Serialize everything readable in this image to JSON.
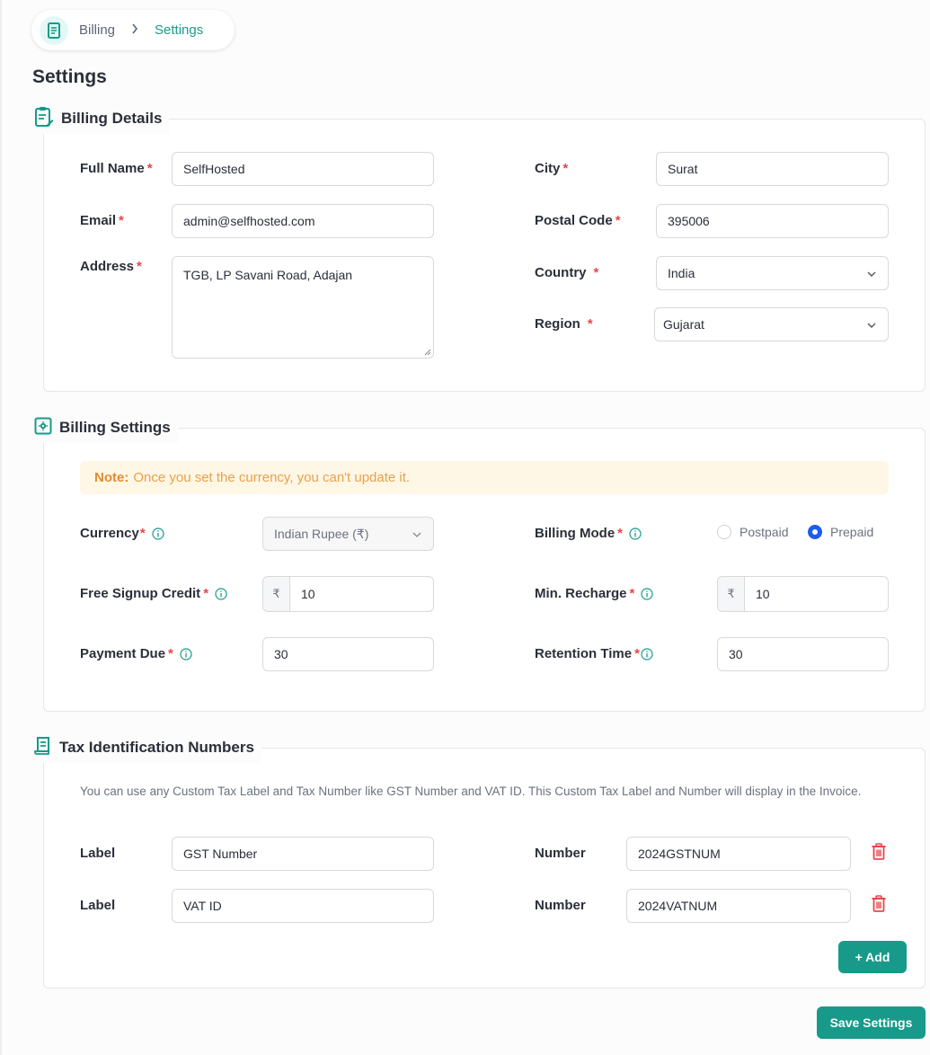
{
  "breadcrumb": {
    "items": [
      "Billing"
    ],
    "separator": ">",
    "current": "Settings",
    "icon": "receipt-icon"
  },
  "page_title": "Settings",
  "billing_details": {
    "title": "Billing Details",
    "icon": "clipboard-edit-icon",
    "fields": {
      "full_name": {
        "label": "Full Name",
        "value": "SelfHosted"
      },
      "email": {
        "label": "Email",
        "value": "admin@selfhosted.com"
      },
      "address": {
        "label": "Address",
        "value": "TGB, LP Savani Road, Adajan"
      },
      "city": {
        "label": "City",
        "value": "Surat"
      },
      "postal_code": {
        "label": "Postal Code",
        "value": "395006"
      },
      "country": {
        "label": "Country",
        "value": "India"
      },
      "region": {
        "label": "Region",
        "value": "Gujarat"
      }
    },
    "required_mark": "*"
  },
  "billing_settings": {
    "title": "Billing Settings",
    "icon": "gear-square-icon",
    "note_label": "Note:",
    "note_text": "Once you set the currency, you can't update it.",
    "currency": {
      "label": "Currency",
      "value": "Indian Rupee (₹)"
    },
    "billing_mode": {
      "label": "Billing Mode",
      "options": [
        "Postpaid",
        "Prepaid"
      ],
      "selected": "Prepaid"
    },
    "free_signup_credit": {
      "label": "Free Signup Credit",
      "prefix": "₹",
      "value": "10"
    },
    "min_recharge": {
      "label": "Min. Recharge",
      "prefix": "₹",
      "value": "10"
    },
    "payment_due": {
      "label": "Payment Due",
      "value": "30"
    },
    "retention_time": {
      "label": "Retention Time",
      "value": "30"
    }
  },
  "tax": {
    "title": "Tax Identification Numbers",
    "icon": "receipt-icon",
    "description": "You can use any Custom Tax Label and Tax Number like GST Number and VAT ID. This Custom Tax Label and Number will display in the Invoice.",
    "rows": [
      {
        "label_caption": "Label",
        "label_value": "GST Number",
        "number_caption": "Number",
        "number_value": "2024GSTNUM"
      },
      {
        "label_caption": "Label",
        "label_value": "VAT ID",
        "number_caption": "Number",
        "number_value": "2024VATNUM"
      }
    ],
    "add_button": "+ Add"
  },
  "save_button": "Save Settings",
  "colors": {
    "accent": "#179a89",
    "required": "#e5484d",
    "note_bg": "#fff7e6",
    "note_text": "#e9a04a",
    "radio_on": "#1d5cf0",
    "danger": "#e5484d"
  }
}
